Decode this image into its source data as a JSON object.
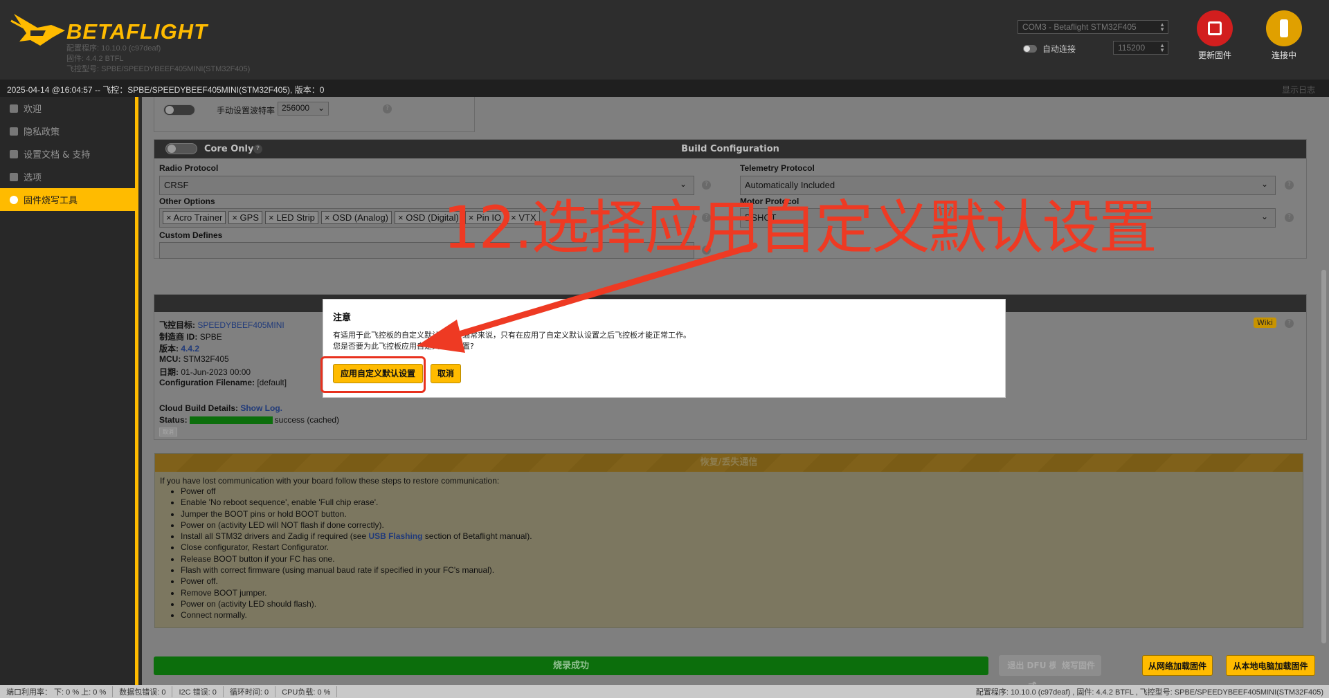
{
  "header": {
    "brand": "BETAFLIGHT",
    "configurator_version": "配置程序: 10.10.0 (c97deaf)",
    "firmware_version": "固件: 4.4.2 BTFL",
    "fc_model": "飞控型号: SPBE/SPEEDYBEEF405MINI(STM32F405)",
    "port": "COM3 - Betaflight STM32F405",
    "auto_connect": "自动连接",
    "baud": "115200",
    "update_firmware": "更新固件",
    "connecting": "连接中"
  },
  "status_strip": {
    "text": "2025-04-14 @16:04:57 -- 飞控：SPBE/SPEEDYBEEF405MINI(STM32F405), 版本：0",
    "show_log": "显示日志"
  },
  "sidebar": {
    "items": [
      {
        "label": "欢迎",
        "icon": "welcome-icon"
      },
      {
        "label": "隐私政策",
        "icon": "privacy-icon"
      },
      {
        "label": "设置文档 & 支持",
        "icon": "docs-icon"
      },
      {
        "label": "选项",
        "icon": "gear-icon"
      },
      {
        "label": "固件烧写工具",
        "icon": "flasher-icon"
      }
    ]
  },
  "top_panel": {
    "manual_baud_label": "手动设置波特率",
    "manual_baud_value": "256000"
  },
  "build_config": {
    "core_only": "Core Only",
    "title": "Build Configuration",
    "radio_protocol_label": "Radio Protocol",
    "radio_protocol_value": "CRSF",
    "telemetry_label": "Telemetry Protocol",
    "telemetry_value": "Automatically Included",
    "other_options_label": "Other Options",
    "other_options": [
      "Acro Trainer",
      "GPS",
      "LED Strip",
      "OSD (Analog)",
      "OSD (Digital)",
      "Pin IO",
      "VTX"
    ],
    "motor_protocol_label": "Motor Protocol",
    "motor_protocol_value": "DSHOT",
    "custom_defines_label": "Custom Defines"
  },
  "target_info": {
    "target_label": "飞控目标:",
    "target_value": "SPEEDYBEEF405MINI",
    "manufacturer_label": "制造商 ID:",
    "manufacturer_value": "SPBE",
    "version_label": "版本:",
    "version_value": "4.4.2",
    "mcu_label": "MCU:",
    "mcu_value": "STM32F405",
    "date_label": "日期:",
    "date_value": "01-Jun-2023 00:00",
    "config_label": "Configuration Filename:",
    "config_value": "[default]",
    "cloud_label": "Cloud Build Details:",
    "cloud_link": "Show Log.",
    "status_label": "Status:",
    "status_value": "success (cached)",
    "wiki": "Wiki",
    "small_btn": "取消"
  },
  "recovery": {
    "title": "恢复/丢失通信",
    "intro": "If you have lost communication with your board follow these steps to restore communication:",
    "steps": [
      "Power off",
      "Enable 'No reboot sequence', enable 'Full chip erase'.",
      "Jumper the BOOT pins or hold BOOT button.",
      "Power on (activity LED will NOT flash if done correctly).",
      "Install all STM32 drivers and Zadig if required (see ",
      "Close configurator, Restart Configurator.",
      "Release BOOT button if your FC has one.",
      "Flash with correct firmware (using manual baud rate if specified in your FC's manual).",
      "Power off.",
      "Remove BOOT jumper.",
      "Power on (activity LED should flash).",
      "Connect normally."
    ],
    "usb_flashing": "USB Flashing",
    "usb_suffix": " section of Betaflight manual)."
  },
  "footer": {
    "progress_label": "烧录成功",
    "progress": 1.0,
    "exit_dfu": "退出 DFU 模式",
    "flash_firmware": "烧写固件",
    "load_online": "从网络加载固件",
    "load_local": "从本地电脑加载固件"
  },
  "dialog": {
    "title": "注意",
    "message_line1": "有适用于此飞控板的自定义默认设置。通常来说，只有在应用了自定义默认设置之后飞控板才能正常工作。",
    "message_line2": "您是否要为此飞控板应用自定义默认设置?",
    "apply": "应用自定义默认设置",
    "cancel": "取消"
  },
  "annotation": {
    "text": "12.选择应用自定义默认设置",
    "color": "#ee3a23"
  },
  "statusbar": {
    "port_usage": "端口利用率： 下: 0 % 上: 0 %",
    "packet_errors": "数据包错误: 0",
    "i2c_errors": "I2C 错误: 0",
    "cycle_time": "循环时间: 0",
    "cpu_load": "CPU负载: 0 %",
    "right": "配置程序: 10.10.0 (c97deaf) , 固件: 4.4.2 BTFL , 飞控型号: SPBE/SPEEDYBEEF405MINI(STM32F405)"
  }
}
